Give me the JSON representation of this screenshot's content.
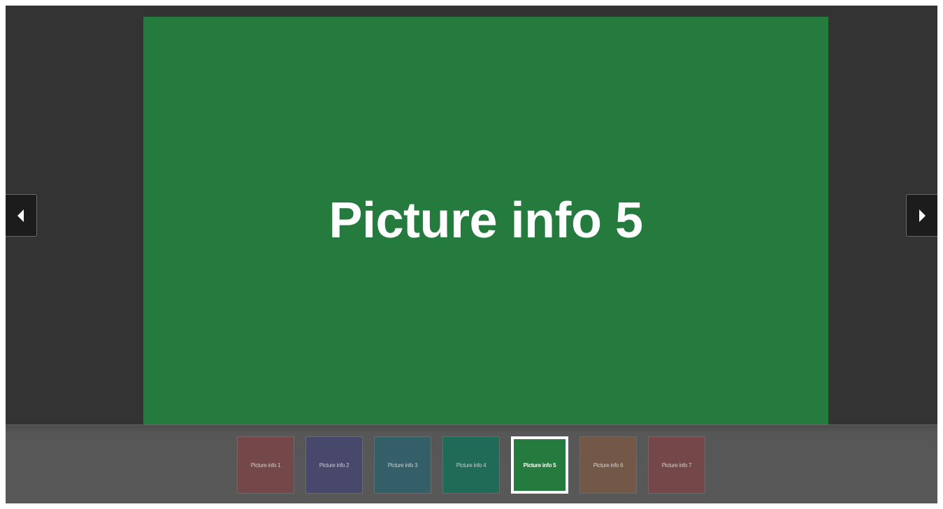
{
  "main": {
    "caption": "Picture info 5",
    "color": "#257b3e"
  },
  "nav": {
    "prev_icon": "triangle-left-icon",
    "next_icon": "triangle-right-icon"
  },
  "thumbnails": [
    {
      "label": "Picture info 1",
      "color": "#744849",
      "active": false
    },
    {
      "label": "Picture info 2",
      "color": "#47486c",
      "active": false
    },
    {
      "label": "Picture info 3",
      "color": "#355f68",
      "active": false
    },
    {
      "label": "Picture info 4",
      "color": "#206a58",
      "active": false
    },
    {
      "label": "Picture info 5",
      "color": "#257b3e",
      "active": true
    },
    {
      "label": "Picture info 6",
      "color": "#735847",
      "active": false
    },
    {
      "label": "Picture info 7",
      "color": "#744849",
      "active": false
    }
  ]
}
